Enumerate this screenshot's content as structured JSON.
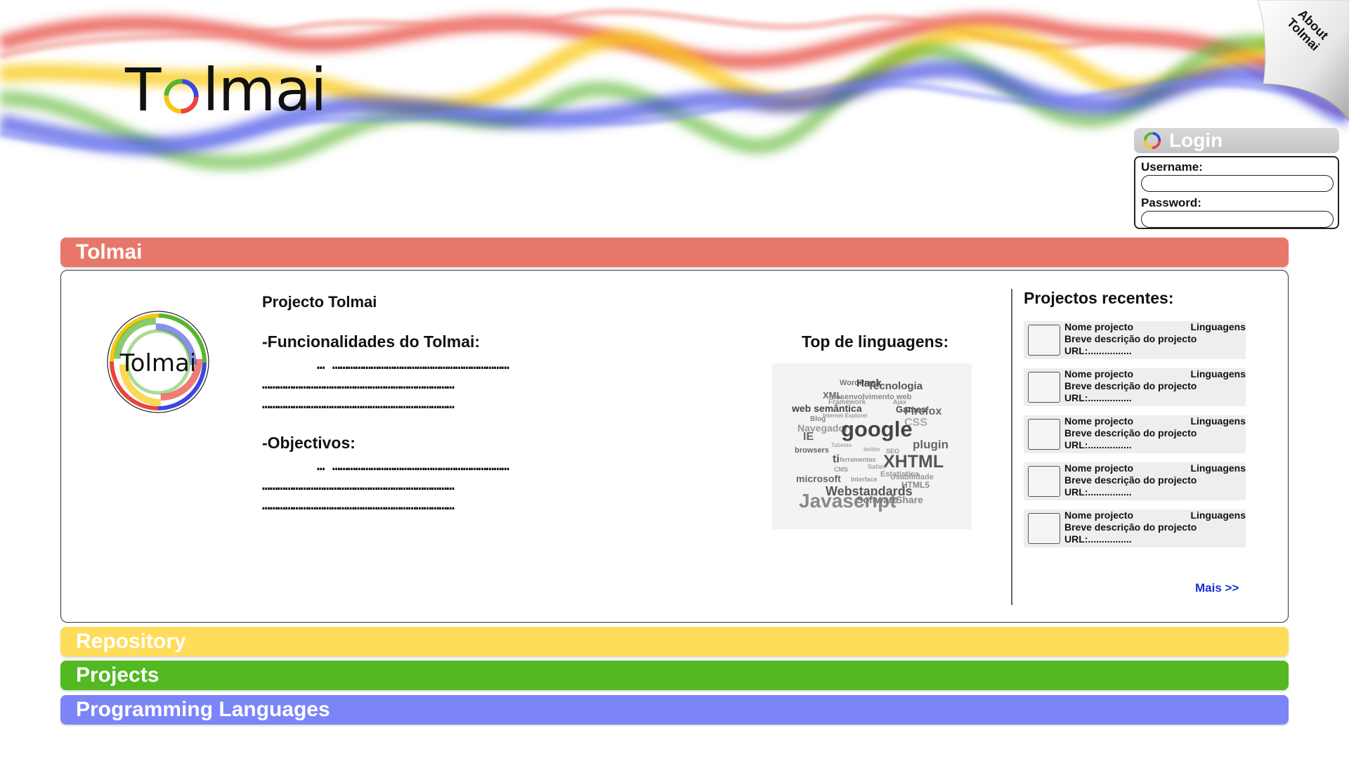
{
  "brand": {
    "name": "Tolmai"
  },
  "about": {
    "label": "About Tolmai"
  },
  "login": {
    "title": "Login",
    "username_label": "Username:",
    "password_label": "Password:",
    "username_value": "",
    "password_value": ""
  },
  "sections": {
    "tolmai": "Tolmai",
    "repository": "Repository",
    "projects": "Projects",
    "languages": "Programming Languages"
  },
  "colors": {
    "tolmai": "#e8776b",
    "repository": "#ffdc5a",
    "projects": "#52b920",
    "languages": "#7b85f8",
    "wave_red": "#e8453c",
    "wave_yellow": "#f9c80e",
    "wave_green": "#59b52f",
    "wave_blue": "#3b47e0",
    "link": "#1a2fd6"
  },
  "main": {
    "project_title": "Projecto Tolmai",
    "features_title": "-Funcionalidades do Tolmai:",
    "objectives_title": "-Objectivos:",
    "dots_first": "… ……………………………………………………………",
    "dots_line": "…………………………………………………………………",
    "top_languages_title": "Top de linguagens:",
    "word_cloud": [
      "WordPress",
      "Hack",
      "Tecnologia",
      "XML",
      "desenvolvimento web",
      "Framework",
      "Ajax",
      "web semântica",
      "Games",
      "Firefox",
      "Blog",
      "Internet Explorer",
      "Navegador",
      "CSS",
      "google",
      "IE",
      "plugin",
      "browsers",
      "SEO",
      "ti",
      "ferramentas",
      "XHTML",
      "CMS",
      "Estatística",
      "microsoft",
      "Interface",
      "Usabilidade",
      "HTML5",
      "Webstandards",
      "Javascript",
      "Software",
      "Share",
      "Safari",
      "twitter",
      "Tabelas"
    ]
  },
  "recent": {
    "title": "Projectos recentes:",
    "items": [
      {
        "name": "Nome projecto",
        "lang": "Linguagens",
        "desc": "Breve descrição do projecto",
        "url": "URL:................"
      },
      {
        "name": "Nome projecto",
        "lang": "Linguagens",
        "desc": "Breve descrição do projecto",
        "url": "URL:................"
      },
      {
        "name": "Nome projecto",
        "lang": "Linguagens",
        "desc": "Breve descrição do projecto",
        "url": "URL:................"
      },
      {
        "name": "Nome projecto",
        "lang": "Linguagens",
        "desc": "Breve descrição do projecto",
        "url": "URL:................"
      },
      {
        "name": "Nome projecto",
        "lang": "Linguagens",
        "desc": "Breve descrição do projecto",
        "url": "URL:................"
      }
    ],
    "more_label": "Mais >>"
  }
}
